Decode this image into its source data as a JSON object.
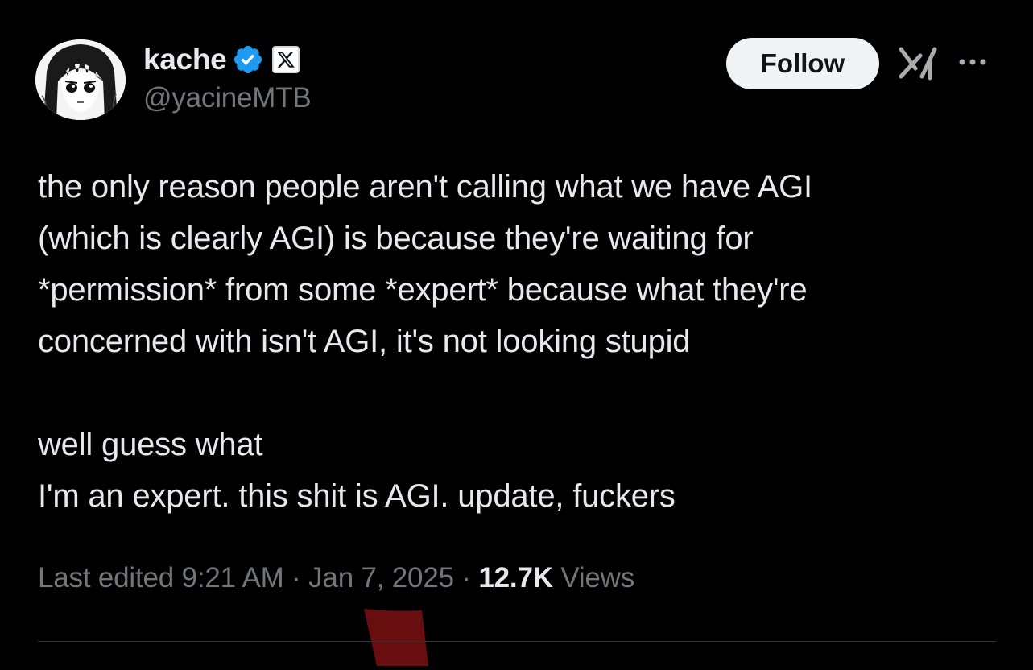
{
  "author": {
    "display_name": "kache",
    "handle": "@yacineMTB",
    "avatar_icon": "anime-avatar-icon",
    "verified_icon": "verified-badge-icon",
    "affiliation_icon": "x-logo-icon"
  },
  "header": {
    "follow_label": "Follow",
    "grok_icon": "grok-icon",
    "more_icon": "more-options-icon"
  },
  "tweet": {
    "line_1": "the only reason people aren't calling what we have AGI",
    "line_2": "(which is clearly AGI) is because they're waiting for",
    "line_3": "*permission* from some *expert* because what they're",
    "line_4": "concerned with isn't AGI, it's not looking stupid",
    "line_5": "well guess what",
    "line_6": "I'm an expert. this shit is AGI. update, fuckers"
  },
  "meta": {
    "edited_label": "Last edited",
    "time": "9:21 AM",
    "separator": "·",
    "date": "Jan 7, 2025",
    "views_count": "12.7K",
    "views_label": "Views"
  },
  "colors": {
    "background": "#000000",
    "text_primary": "#e7e9ea",
    "text_secondary": "#71767b",
    "verified_blue": "#1d9bf0",
    "follow_bg": "#eff3f4",
    "divider": "#2f3336"
  }
}
